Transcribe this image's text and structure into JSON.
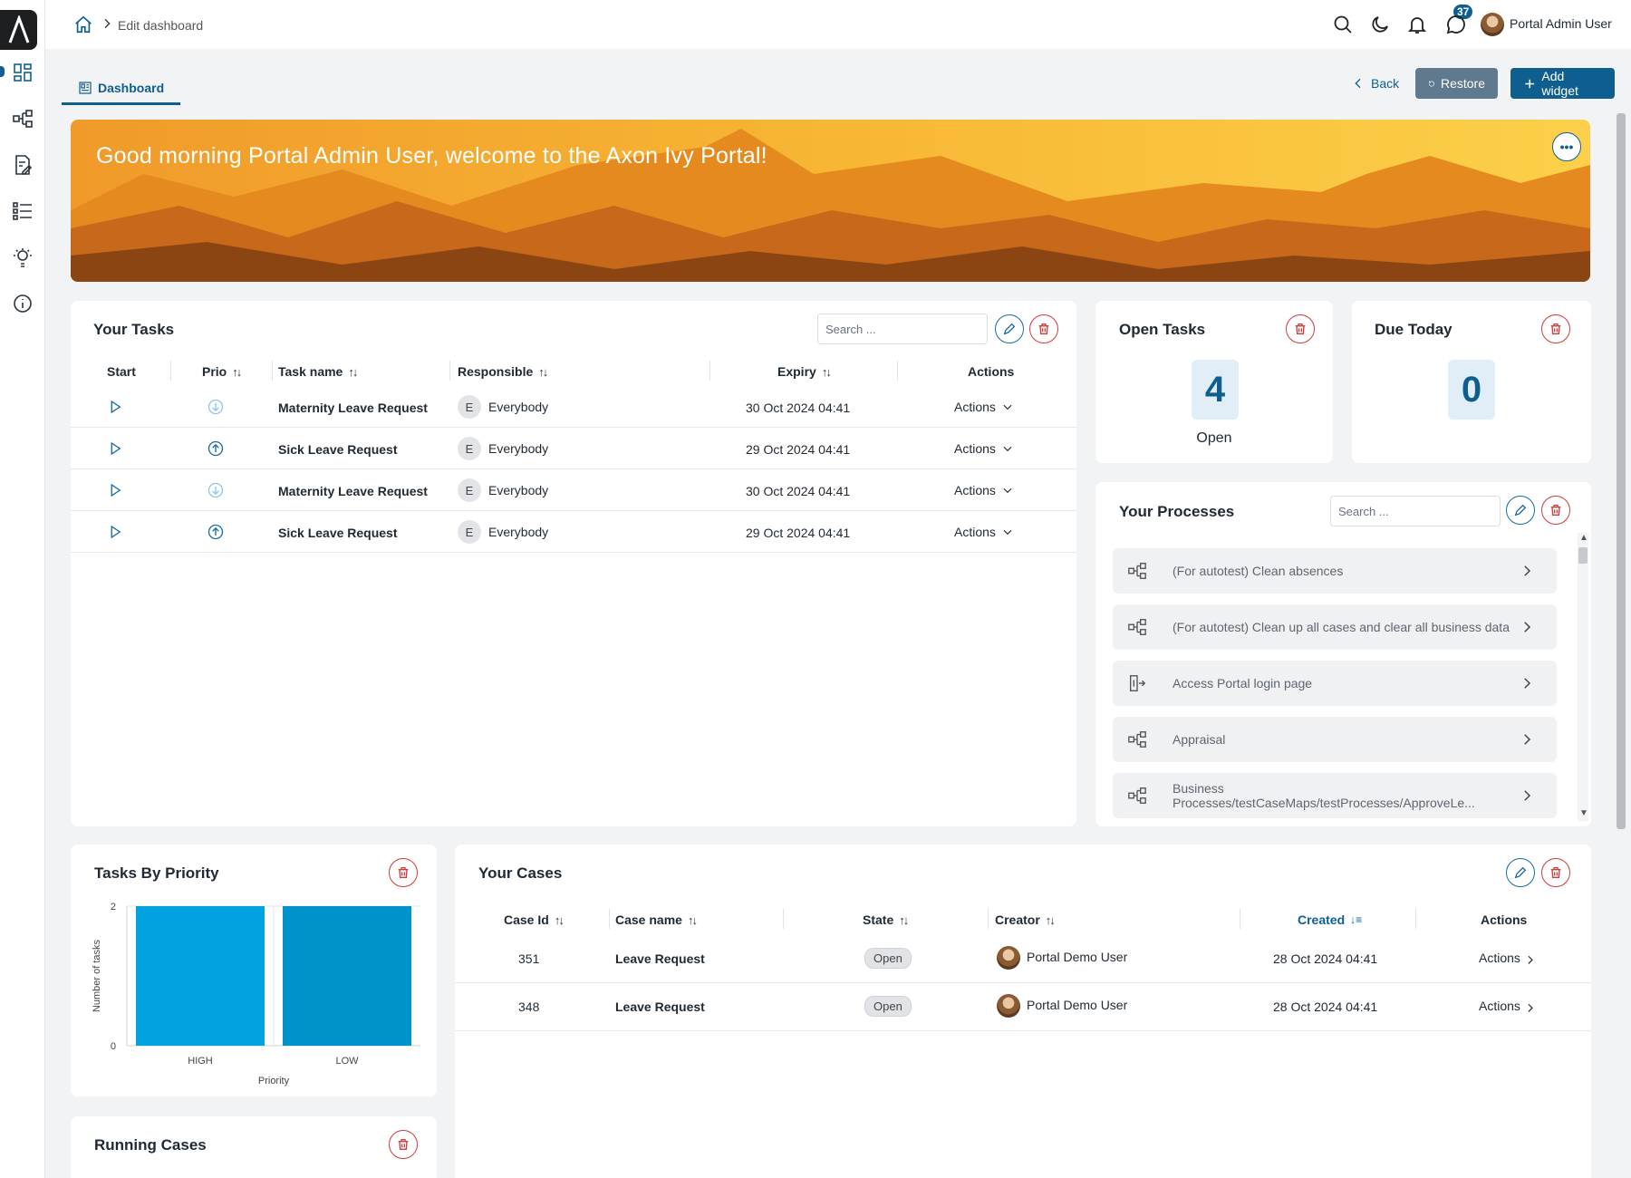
{
  "breadcrumb": {
    "current": "Edit dashboard"
  },
  "header": {
    "notifications_count": "37",
    "user_name": "Portal Admin User"
  },
  "tabs": [
    {
      "label": "Dashboard"
    }
  ],
  "toolbar": {
    "back_label": "Back",
    "restore_label": "Restore",
    "add_widget_label": "Add widget"
  },
  "banner": {
    "greeting": "Good morning Portal Admin User, welcome to the Axon Ivy Portal!",
    "more_label": "•••"
  },
  "your_tasks": {
    "title": "Your Tasks",
    "search_placeholder": "Search ...",
    "columns": [
      "Start",
      "Prio",
      "Task name",
      "Responsible",
      "Expiry",
      "Actions"
    ],
    "rows": [
      {
        "prio": "low",
        "name": "Maternity Leave Request",
        "responsible_initial": "E",
        "responsible": "Everybody",
        "expiry": "30 Oct 2024 04:41",
        "actions": "Actions"
      },
      {
        "prio": "high",
        "name": "Sick Leave Request",
        "responsible_initial": "E",
        "responsible": "Everybody",
        "expiry": "29 Oct 2024 04:41",
        "actions": "Actions"
      },
      {
        "prio": "low",
        "name": "Maternity Leave Request",
        "responsible_initial": "E",
        "responsible": "Everybody",
        "expiry": "30 Oct 2024 04:41",
        "actions": "Actions"
      },
      {
        "prio": "high",
        "name": "Sick Leave Request",
        "responsible_initial": "E",
        "responsible": "Everybody",
        "expiry": "29 Oct 2024 04:41",
        "actions": "Actions"
      }
    ]
  },
  "open_tasks": {
    "title": "Open Tasks",
    "count": "4",
    "caption": "Open"
  },
  "due_today": {
    "title": "Due Today",
    "count": "0"
  },
  "your_processes": {
    "title": "Your Processes",
    "search_placeholder": "Search ...",
    "items": [
      {
        "label": "(For autotest) Clean absences",
        "icon": "process-icon"
      },
      {
        "label": "(For autotest) Clean up all cases and clear all business data",
        "icon": "process-icon"
      },
      {
        "label": "Access Portal login page",
        "icon": "login-page-icon"
      },
      {
        "label": "Appraisal",
        "icon": "process-icon"
      },
      {
        "label": "Business Processes/testCaseMaps/testProcesses/ApproveLe...",
        "icon": "process-icon"
      }
    ]
  },
  "tasks_by_priority": {
    "title": "Tasks By Priority",
    "chart_data": {
      "type": "bar",
      "categories": [
        "HIGH",
        "LOW"
      ],
      "values": [
        2,
        2
      ],
      "title": "",
      "xlabel": "Priority",
      "ylabel": "Number of tasks",
      "ylim": [
        0,
        2
      ],
      "yticks": [
        "0",
        "2"
      ],
      "colors": [
        "#00a3df",
        "#0093c9"
      ],
      "grid": true
    }
  },
  "your_cases": {
    "title": "Your Cases",
    "columns": [
      "Case Id",
      "Case name",
      "State",
      "Creator",
      "Created",
      "Actions"
    ],
    "rows": [
      {
        "id": "351",
        "name": "Leave Request",
        "state": "Open",
        "creator": "Portal Demo User",
        "created": "28 Oct 2024 04:41",
        "actions": "Actions"
      },
      {
        "id": "348",
        "name": "Leave Request",
        "state": "Open",
        "creator": "Portal Demo User",
        "created": "28 Oct 2024 04:41",
        "actions": "Actions"
      }
    ]
  },
  "running_cases": {
    "title": "Running Cases"
  },
  "colors": {
    "primary": "#0e5f8f",
    "danger": "#d13b3b",
    "restore_btn": "#5f7a8e"
  }
}
